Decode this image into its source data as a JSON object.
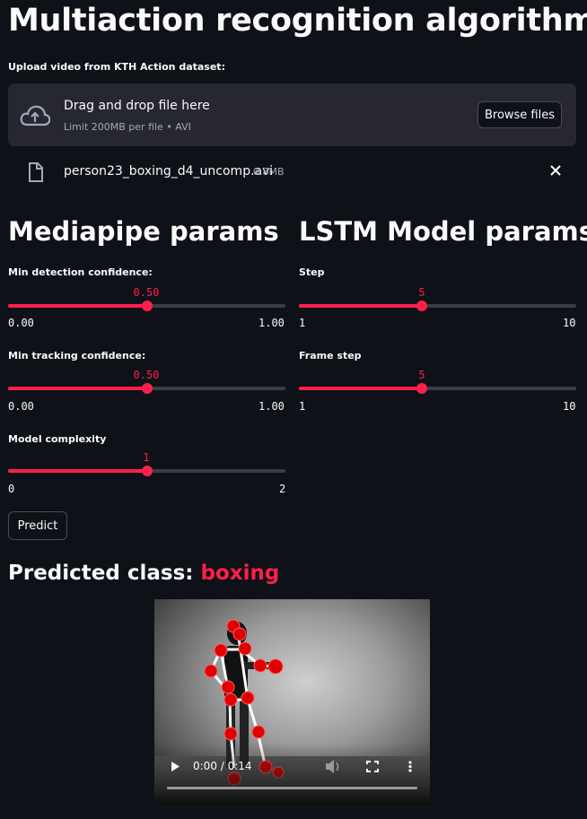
{
  "title": "Multiaction recognition algorithm",
  "uploader": {
    "label": "Upload video from KTH Action dataset:",
    "drop_text": "Drag and drop file here",
    "limit_text": "Limit 200MB per file • AVI",
    "browse_label": "Browse files",
    "file_name": "person23_boxing_d4_uncomp.avi",
    "file_size": "0.8MB"
  },
  "mediapipe": {
    "heading": "Mediapipe params",
    "sliders": [
      {
        "label": "Min detection confidence:",
        "value": "0.50",
        "min": "0.00",
        "max": "1.00",
        "fraction": 0.5
      },
      {
        "label": "Min tracking confidence:",
        "value": "0.50",
        "min": "0.00",
        "max": "1.00",
        "fraction": 0.5
      },
      {
        "label": "Model complexity",
        "value": "1",
        "min": "0",
        "max": "2",
        "fraction": 0.5
      }
    ]
  },
  "lstm": {
    "heading": "LSTM Model params",
    "sliders": [
      {
        "label": "Step",
        "value": "5",
        "min": "1",
        "max": "10",
        "fraction": 0.444
      },
      {
        "label": "Frame step",
        "value": "5",
        "min": "1",
        "max": "10",
        "fraction": 0.444
      }
    ]
  },
  "predict_label": "Predict",
  "prediction": {
    "label": "Predicted class:",
    "value": "boxing"
  },
  "video": {
    "time": "0:00 / 0:14"
  },
  "colors": {
    "accent": "#ff1f4b",
    "background": "#0e1117",
    "panel": "#262730"
  }
}
